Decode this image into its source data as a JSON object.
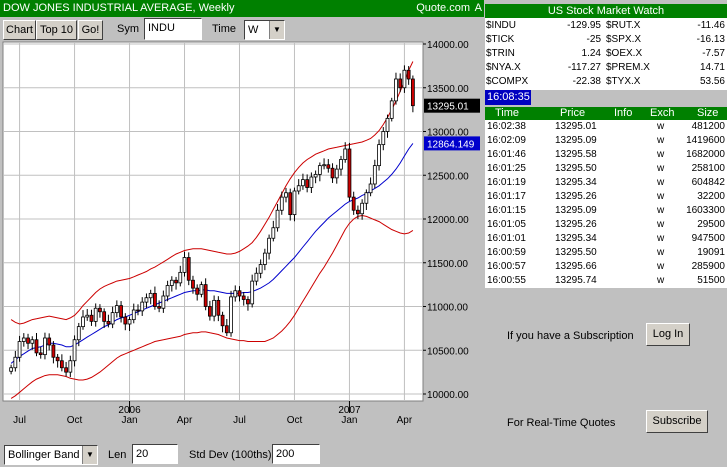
{
  "header": {
    "title": "DOW JONES INDUSTRIAL AVERAGE",
    "period": ", Weekly",
    "brand": "Quote.com",
    "brand_suffix": "A"
  },
  "toolbar": {
    "chart_label": "Chart",
    "top10_label": "Top 10",
    "go_label": "Go!",
    "sym_label": "Sym",
    "sym_value": "INDU",
    "time_label": "Time",
    "time_value": "W"
  },
  "bottom": {
    "study_value": "Bollinger Band",
    "len_label": "Len",
    "len_value": "20",
    "stddev_label": "Std Dev (100ths)",
    "stddev_value": "200"
  },
  "watch": {
    "title": "US Stock Market Watch",
    "rows": [
      {
        "s1": "$INDU",
        "v1": "-129.95",
        "s2": "$RUT.X",
        "v2": "-11.46"
      },
      {
        "s1": "$TICK",
        "v1": "-25",
        "s2": "$SPX.X",
        "v2": "-16.13"
      },
      {
        "s1": "$TRIN",
        "v1": "1.24",
        "s2": "$OEX.X",
        "v2": "-7.57"
      },
      {
        "s1": "$NYA.X",
        "v1": "-117.27",
        "s2": "$PREM.X",
        "v2": "14.71"
      },
      {
        "s1": "$COMPX",
        "v1": "-22.38",
        "s2": "$TYX.X",
        "v2": "53.56"
      }
    ],
    "time": "16:08:35"
  },
  "trades": {
    "headers": [
      "Time",
      "Price",
      "Info",
      "Exch",
      "Size"
    ],
    "rows": [
      {
        "time": "16:02:38",
        "price": "13295.01",
        "exch": "w",
        "size": "481200"
      },
      {
        "time": "16:02:09",
        "price": "13295.09",
        "exch": "w",
        "size": "1419600"
      },
      {
        "time": "16:01:46",
        "price": "13295.58",
        "exch": "w",
        "size": "1682000"
      },
      {
        "time": "16:01:25",
        "price": "13295.50",
        "exch": "w",
        "size": "258100"
      },
      {
        "time": "16:01:19",
        "price": "13295.34",
        "exch": "w",
        "size": "604842"
      },
      {
        "time": "16:01:17",
        "price": "13295.26",
        "exch": "w",
        "size": "32200"
      },
      {
        "time": "16:01:15",
        "price": "13295.09",
        "exch": "w",
        "size": "1603300"
      },
      {
        "time": "16:01:05",
        "price": "13295.26",
        "exch": "w",
        "size": "29500"
      },
      {
        "time": "16:01:01",
        "price": "13295.34",
        "exch": "w",
        "size": "947500"
      },
      {
        "time": "16:00:59",
        "price": "13295.50",
        "exch": "w",
        "size": "19091"
      },
      {
        "time": "16:00:57",
        "price": "13295.66",
        "exch": "w",
        "size": "285900"
      },
      {
        "time": "16:00:55",
        "price": "13295.74",
        "exch": "w",
        "size": "51500"
      }
    ]
  },
  "subscription": {
    "text1": "If you have a Subscription",
    "login_label": "Log In",
    "text2": "For Real-Time Quotes",
    "subscribe_label": "Subscribe"
  },
  "chart_data": {
    "type": "candlestick",
    "period": "Weekly",
    "ylim": [
      10000,
      14000
    ],
    "yticks": [
      10000,
      10500,
      11000,
      11500,
      12000,
      12500,
      13000,
      13500,
      14000
    ],
    "ytick_labels": [
      "10000.00",
      "10500.00",
      "11000.00",
      "11500.00",
      "12000.00",
      "12500.00",
      "13000.00",
      "13500.00",
      "14000.00"
    ],
    "xtick_labels": [
      "Jul",
      "Oct",
      "Jan",
      "Apr",
      "Jul",
      "Oct",
      "Jan",
      "Apr"
    ],
    "xtick_weeks": [
      2,
      15,
      28,
      41,
      54,
      67,
      80,
      93
    ],
    "year_labels": [
      {
        "text": "2006",
        "week": 28
      },
      {
        "text": "2007",
        "week": 80
      }
    ],
    "last_price_label": "13295.01",
    "sma_label": "12864.149",
    "colors": {
      "up": "#ffffff",
      "down": "#cc0000",
      "sma": "#0000cc",
      "band": "#cc0000",
      "grid": "#c0c0c0"
    },
    "closes": [
      10300,
      10420,
      10600,
      10640,
      10580,
      10620,
      10470,
      10450,
      10640,
      10560,
      10420,
      10380,
      10300,
      10250,
      10380,
      10620,
      10770,
      10880,
      10900,
      10830,
      10980,
      10940,
      10830,
      10800,
      10930,
      11010,
      10880,
      10800,
      10850,
      10960,
      10950,
      11050,
      11100,
      11150,
      11000,
      10980,
      11120,
      11240,
      11300,
      11270,
      11390,
      11560,
      11300,
      11210,
      11140,
      11250,
      11000,
      10890,
      11070,
      10900,
      10780,
      10700,
      11110,
      11180,
      11120,
      11080,
      11030,
      11290,
      11380,
      11480,
      11610,
      11780,
      11900,
      12100,
      12250,
      12300,
      12050,
      12320,
      12380,
      12450,
      12360,
      12480,
      12510,
      12610,
      12620,
      12580,
      12470,
      12570,
      12680,
      12800,
      12250,
      12100,
      12060,
      12180,
      12300,
      12400,
      12610,
      12850,
      13000,
      13150,
      13350,
      13600,
      13500,
      13700,
      13600,
      13295
    ],
    "sma": [
      10350,
      10390,
      10430,
      10460,
      10490,
      10520,
      10530,
      10540,
      10560,
      10580,
      10580,
      10570,
      10560,
      10540,
      10540,
      10560,
      10590,
      10620,
      10650,
      10680,
      10710,
      10740,
      10770,
      10790,
      10820,
      10850,
      10870,
      10880,
      10900,
      10920,
      10940,
      10960,
      10980,
      11000,
      11020,
      11040,
      11060,
      11080,
      11100,
      11120,
      11140,
      11160,
      11170,
      11180,
      11180,
      11190,
      11190,
      11180,
      11180,
      11170,
      11160,
      11150,
      11150,
      11150,
      11150,
      11160,
      11160,
      11170,
      11190,
      11210,
      11240,
      11270,
      11310,
      11360,
      11410,
      11460,
      11510,
      11560,
      11620,
      11680,
      11740,
      11800,
      11860,
      11910,
      11960,
      12010,
      12050,
      12090,
      12130,
      12170,
      12200,
      12220,
      12240,
      12270,
      12290,
      12320,
      12350,
      12380,
      12420,
      12460,
      12510,
      12570,
      12640,
      12720,
      12800,
      12864
    ],
    "upper_band": [
      10850,
      10820,
      10800,
      10810,
      10830,
      10850,
      10860,
      10870,
      10880,
      10890,
      10880,
      10870,
      10860,
      10850,
      10870,
      10900,
      10950,
      11010,
      11060,
      11110,
      11160,
      11200,
      11230,
      11250,
      11270,
      11290,
      11300,
      11310,
      11320,
      11340,
      11360,
      11380,
      11400,
      11430,
      11450,
      11480,
      11510,
      11540,
      11570,
      11600,
      11620,
      11640,
      11650,
      11660,
      11660,
      11660,
      11650,
      11640,
      11630,
      11620,
      11610,
      11600,
      11600,
      11610,
      11630,
      11660,
      11690,
      11730,
      11790,
      11860,
      11940,
      12020,
      12110,
      12200,
      12290,
      12380,
      12460,
      12530,
      12590,
      12640,
      12680,
      12710,
      12740,
      12760,
      12780,
      12800,
      12810,
      12820,
      12830,
      12840,
      12850,
      12860,
      12870,
      12880,
      12900,
      12920,
      12960,
      13010,
      13080,
      13160,
      13250,
      13350,
      13460,
      13570,
      13700,
      13800
    ],
    "lower_band": [
      9950,
      9980,
      10020,
      10060,
      10100,
      10140,
      10170,
      10190,
      10210,
      10220,
      10220,
      10220,
      10210,
      10200,
      10180,
      10170,
      10160,
      10160,
      10170,
      10190,
      10220,
      10250,
      10290,
      10330,
      10370,
      10410,
      10440,
      10460,
      10480,
      10500,
      10520,
      10540,
      10560,
      10580,
      10600,
      10610,
      10620,
      10630,
      10640,
      10650,
      10660,
      10680,
      10690,
      10700,
      10700,
      10710,
      10710,
      10700,
      10690,
      10680,
      10660,
      10640,
      10630,
      10620,
      10610,
      10610,
      10600,
      10600,
      10600,
      10600,
      10600,
      10620,
      10640,
      10680,
      10720,
      10770,
      10830,
      10900,
      10980,
      11060,
      11140,
      11220,
      11300,
      11380,
      11450,
      11530,
      11610,
      11700,
      11790,
      11880,
      11950,
      12000,
      12030,
      12040,
      12030,
      12010,
      11990,
      11970,
      11940,
      11910,
      11880,
      11860,
      11840,
      11830,
      11840,
      11870
    ]
  }
}
